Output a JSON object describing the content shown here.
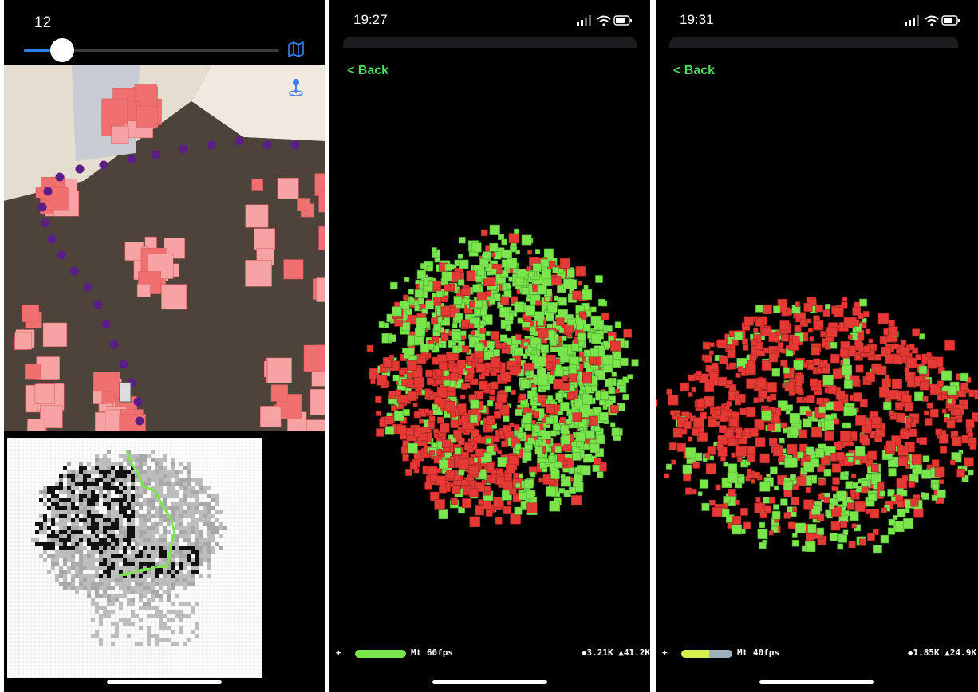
{
  "panel1": {
    "slider_value": "12",
    "slider_fraction": 0.15,
    "icons": {
      "map": "map-icon",
      "pin": "location-pin-icon"
    }
  },
  "panel2": {
    "time": "19:27",
    "back_label": "< Back",
    "stats": {
      "plus": "+",
      "fps": "Mt 60fps",
      "counts": "◆3.21K ▲41.2K"
    }
  },
  "panel3": {
    "time": "19:31",
    "back_label": "< Back",
    "stats": {
      "plus": "+",
      "fps": "Mt 40fps",
      "counts": "◆1.85K ▲24.9K"
    }
  },
  "colors": {
    "accent": "#4cd964",
    "slider": "#2f80ed",
    "occupied": "#e53935",
    "free": "#7be64b",
    "path": "#5b1e86",
    "block": "#f07070"
  }
}
